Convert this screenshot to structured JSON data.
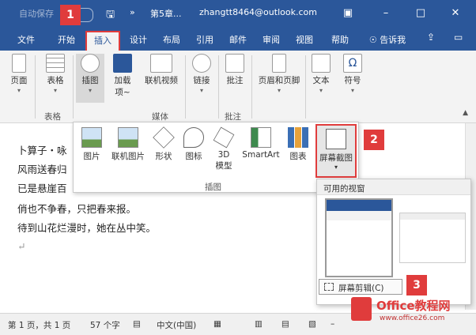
{
  "titlebar": {
    "autosave": "自动保存",
    "toggle_state": "关",
    "doc_title": "第5章...",
    "user_email": "zhangtt8464@outlook.com"
  },
  "tabs": [
    {
      "label": "文件"
    },
    {
      "label": "开始"
    },
    {
      "label": "插入",
      "active": true
    },
    {
      "label": "设计"
    },
    {
      "label": "布局"
    },
    {
      "label": "引用"
    },
    {
      "label": "邮件"
    },
    {
      "label": "审阅"
    },
    {
      "label": "视图"
    },
    {
      "label": "帮助"
    },
    {
      "label": "告诉我"
    }
  ],
  "ribbon": {
    "pages": "页面",
    "table": "表格",
    "illustrations": "插图",
    "addins": "加载\n项~",
    "online_video": "联机视频",
    "links": "链接",
    "comment": "批注",
    "header_footer": "页眉和页脚",
    "text": "文本",
    "symbols": "符号",
    "group_table": "表格",
    "group_media": "媒体",
    "group_comment": "批注"
  },
  "illustrations_panel": {
    "picture": "图片",
    "online_picture": "联机图片",
    "shapes": "形状",
    "icons": "图标",
    "model_3d_l1": "3D",
    "model_3d_l2": "模型",
    "smartart": "SmartArt",
    "chart": "图表",
    "screenshot": "屏幕截图",
    "group_label": "插图"
  },
  "screenshot_panel": {
    "heading": "可用的视窗",
    "clipping": "屏幕剪辑(C)"
  },
  "document": {
    "lines": [
      "卜算子・咏",
      "风雨送春归",
      "已是悬崖百",
      "俏也不争春，只把春来报。",
      "待到山花烂漫时，她在丛中笑。"
    ]
  },
  "badges": [
    "1",
    "2",
    "3"
  ],
  "status": {
    "page": "第 1 页，共 1 页",
    "words": "57 个字",
    "language": "中文(中国)"
  },
  "watermark": {
    "brand": "Office教程网",
    "url": "www.office26.com"
  }
}
